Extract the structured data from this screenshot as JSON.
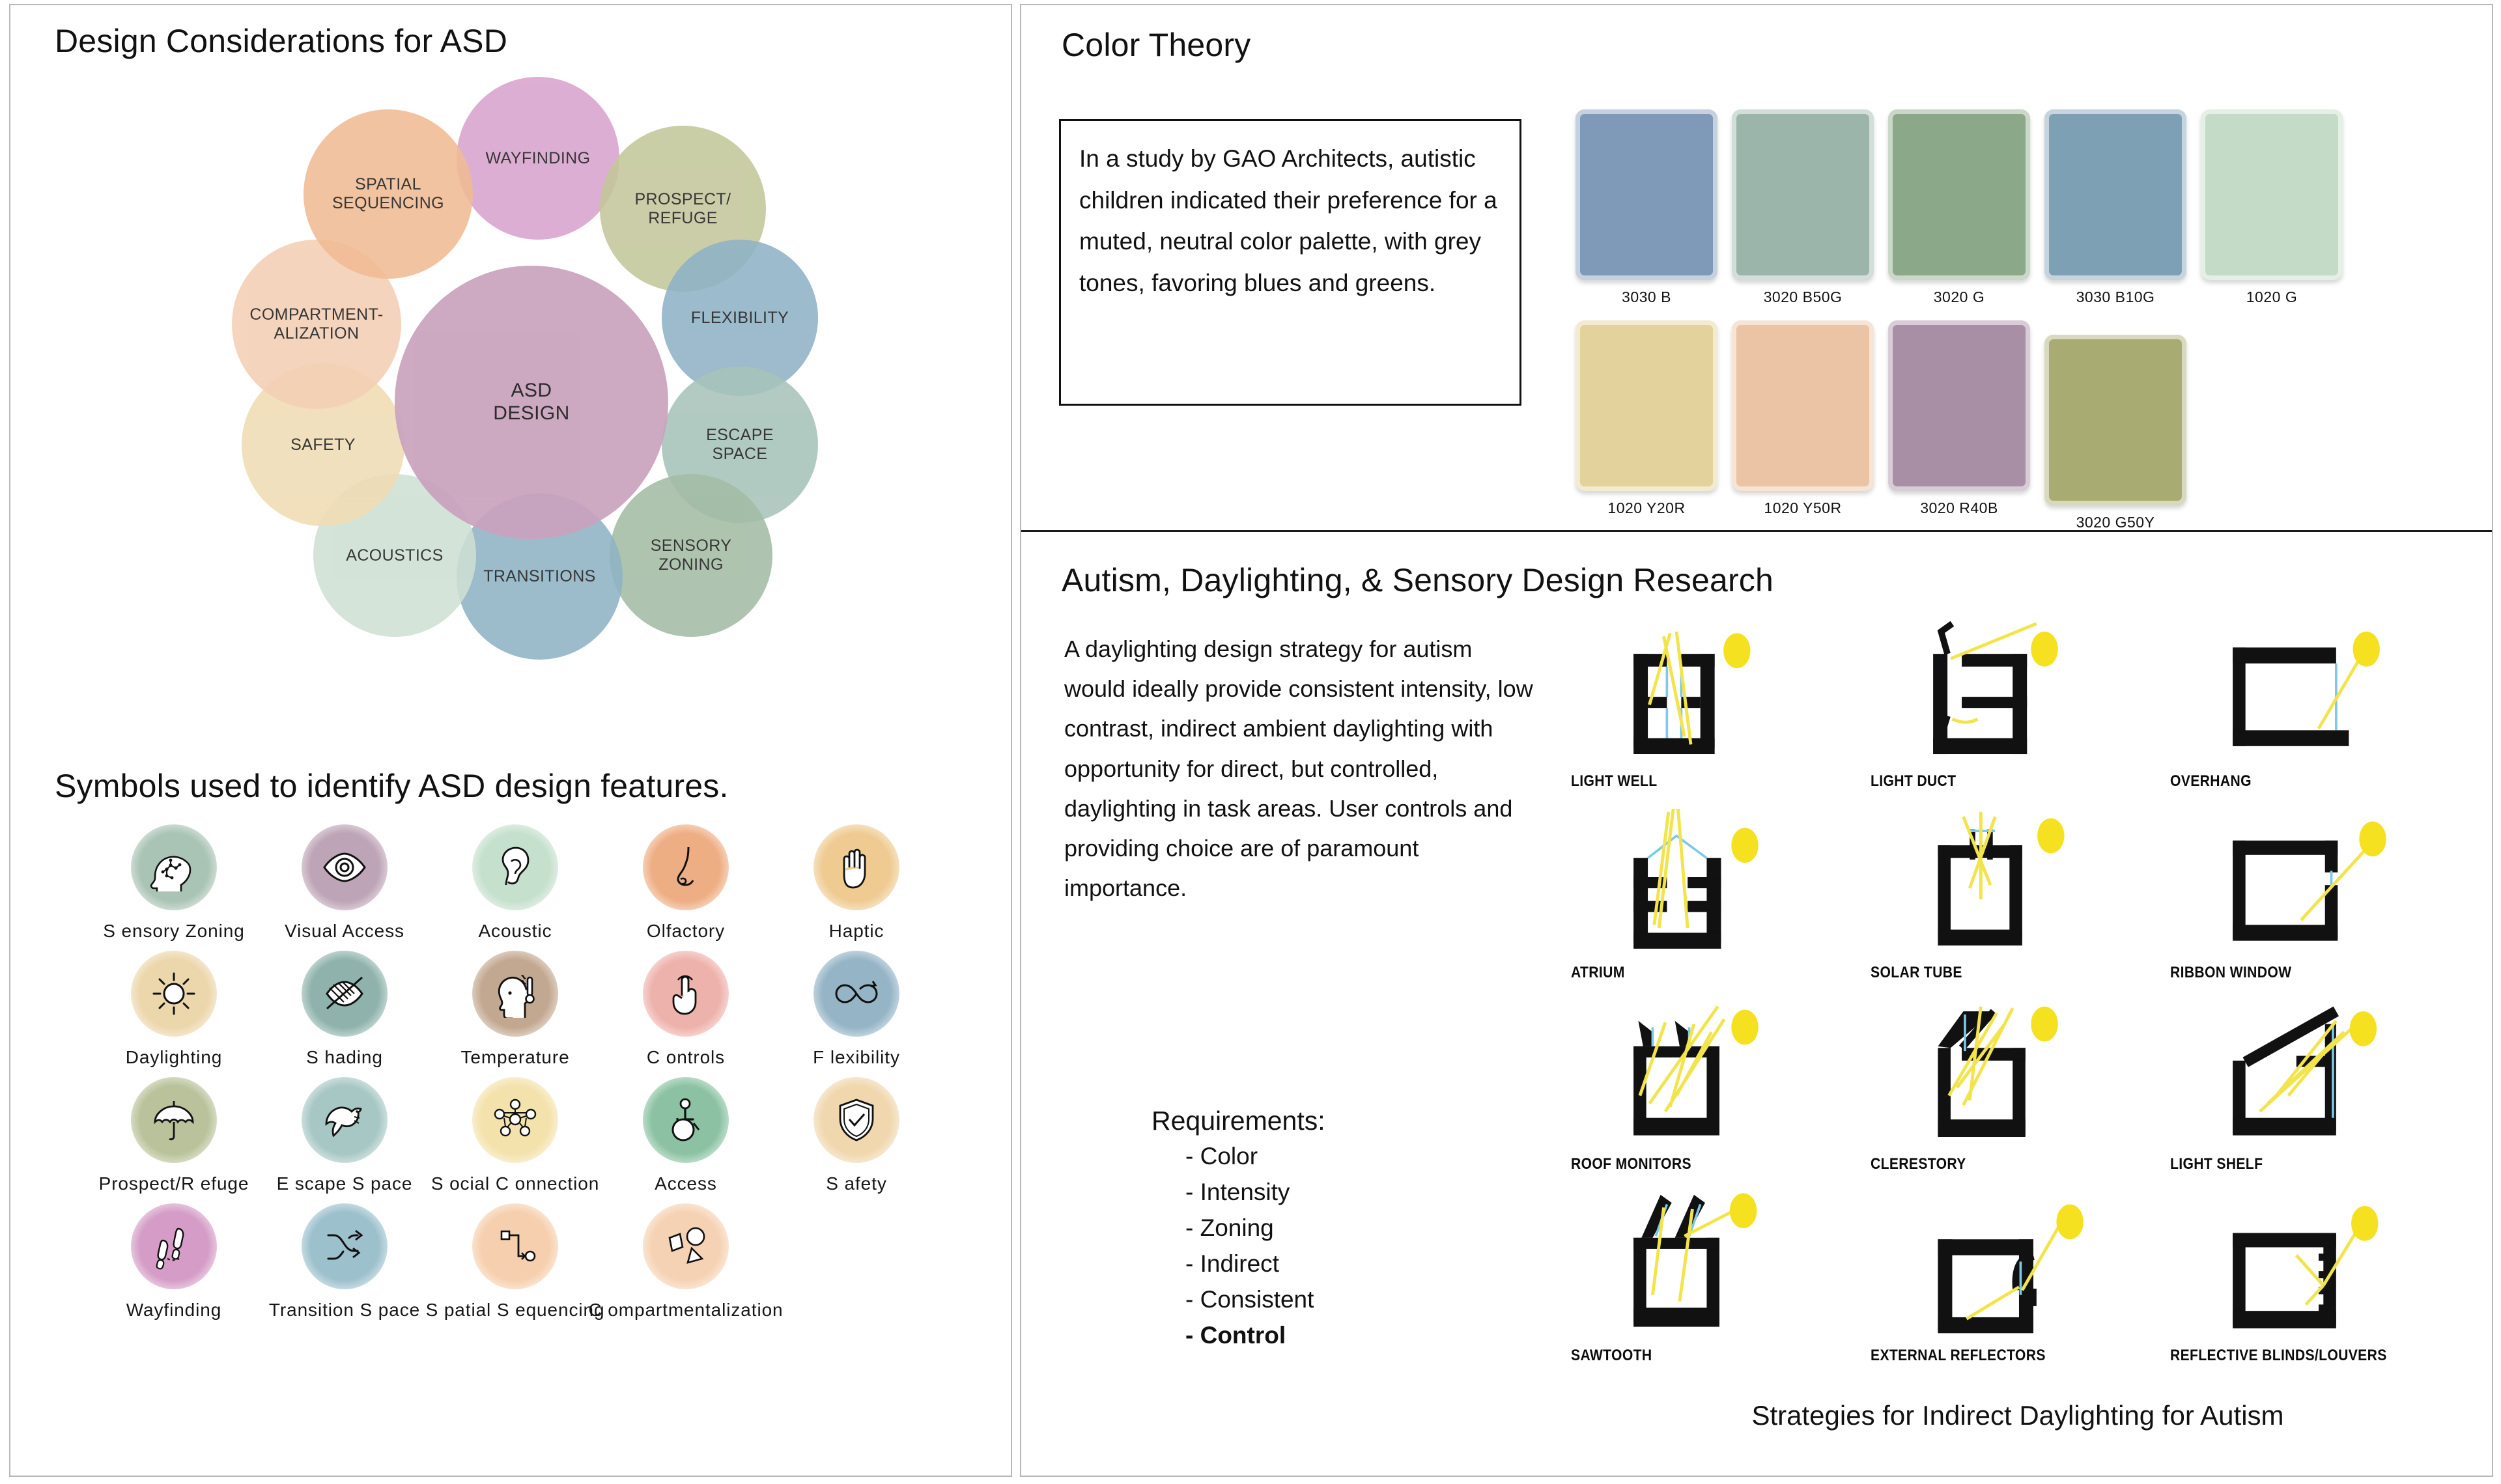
{
  "left_panel": {
    "title": "Design Considerations for ASD",
    "bubble_diagram": {
      "core_label": "ASD\nDESIGN",
      "bubbles": [
        {
          "label": "WAYFINDING",
          "color": "#d9a3cd"
        },
        {
          "label": "PROSPECT/\nREFUGE",
          "color": "#c3c79b"
        },
        {
          "label": "FLEXIBILITY",
          "color": "#8fb2c6"
        },
        {
          "label": "ESCAPE\nSPACE",
          "color": "#a7c3b9"
        },
        {
          "label": "SENSORY\nZONING",
          "color": "#a3bca5"
        },
        {
          "label": "TRANSITIONS",
          "color": "#8fb3c4"
        },
        {
          "label": "ACOUSTICS",
          "color": "#cfe0d3"
        },
        {
          "label": "SAFETY",
          "color": "#f0dcb4"
        },
        {
          "label": "COMPARTMENT-\nALIZATION",
          "color": "#f4cfb4"
        },
        {
          "label": "SPATIAL\nSEQUENCING",
          "color": "#f0bb94"
        }
      ],
      "core_color": "#c9a2bd"
    },
    "symbols_title": "Symbols used to identify ASD design features.",
    "symbol_rows": [
      [
        {
          "label": "S ensory Zoning",
          "icon": "head-circuit-icon",
          "color": "#a9c3b4"
        },
        {
          "label": "Visual Access",
          "icon": "eye-icon",
          "color": "#bda4b6"
        },
        {
          "label": "Acoustic",
          "icon": "ear-icon",
          "color": "#c5e0cd"
        },
        {
          "label": "Olfactory",
          "icon": "nose-icon",
          "color": "#eeae84"
        },
        {
          "label": "Haptic",
          "icon": "hand-open-icon",
          "color": "#efcb92"
        }
      ],
      [
        {
          "label": "Daylighting",
          "icon": "sun-icon",
          "color": "#ecd6ab"
        },
        {
          "label": "S hading",
          "icon": "eye-slash-icon",
          "color": "#8fb3ac"
        },
        {
          "label": "Temperature",
          "icon": "head-thermometer-icon",
          "color": "#c3a891"
        },
        {
          "label": "C ontrols",
          "icon": "finger-tap-icon",
          "color": "#eeb2ac"
        },
        {
          "label": "F lexibility",
          "icon": "infinity-icon",
          "color": "#95b4c6"
        }
      ],
      [
        {
          "label": "Prospect/R efuge",
          "icon": "umbrella-icon",
          "color": "#b9c29a"
        },
        {
          "label": "E scape S pace",
          "icon": "dove-icon",
          "color": "#a7c7c4"
        },
        {
          "label": "S ocial C onnection",
          "icon": "network-icon",
          "color": "#f4e2ac"
        },
        {
          "label": "Access",
          "icon": "wheelchair-icon",
          "color": "#8cc2a3"
        },
        {
          "label": "S afety",
          "icon": "shield-check-icon",
          "color": "#f0d7ae"
        }
      ],
      [
        {
          "label": "Wayfinding",
          "icon": "footsteps-icon",
          "color": "#d49cc6"
        },
        {
          "label": "Transition S pace",
          "icon": "shuffle-icon",
          "color": "#9cc0cc"
        },
        {
          "label": "S patial S equencing",
          "icon": "sequence-path-icon",
          "color": "#f6cfae"
        },
        {
          "label": "C ompartmentalization",
          "icon": "shapes-icon",
          "color": "#f6d2b4"
        }
      ]
    ]
  },
  "right_top": {
    "title": "Color Theory",
    "quote": "In a study by GAO Architects, autistic children indicated their preference for a muted, neutral color palette, with grey tones, favoring blues and greens.",
    "swatch_rows": [
      [
        {
          "name": "3030 B",
          "color": "#7e9ab8"
        },
        {
          "name": "3020 B50G",
          "color": "#9cb5ab"
        },
        {
          "name": "3020 G",
          "color": "#8ba888"
        },
        {
          "name": "3030 B10G",
          "color": "#7ea0b5"
        },
        {
          "name": "1020 G",
          "color": "#c3dbc7"
        }
      ],
      [
        {
          "name": "1020 Y20R",
          "color": "#e3d29c"
        },
        {
          "name": "1020 Y50R",
          "color": "#eac4a4"
        },
        {
          "name": "3020 R40B",
          "color": "#a98fa6"
        },
        {
          "name": "3020 G50Y",
          "color": "#a8ac72"
        }
      ]
    ]
  },
  "right_bottom": {
    "title": "Autism, Daylighting, & Sensory Design Research",
    "paragraph": "A daylighting design strategy for autism would ideally provide consistent intensity, low contrast, indirect ambient daylighting with opportunity for direct, but controlled, daylighting in task areas. User controls and providing choice are of paramount importance.",
    "requirements_heading": "Requirements:",
    "requirements": [
      "- Color",
      "- Intensity",
      "- Zoning",
      "- Indirect",
      "- Consistent",
      "- Control"
    ],
    "diagram_caption": "Strategies for Indirect Daylighting for Autism",
    "diagram_rows": [
      [
        {
          "label": "LIGHT WELL"
        },
        {
          "label": "LIGHT DUCT"
        },
        {
          "label": "OVERHANG"
        }
      ],
      [
        {
          "label": "ATRIUM"
        },
        {
          "label": "SOLAR TUBE"
        },
        {
          "label": "RIBBON WINDOW"
        }
      ],
      [
        {
          "label": "ROOF MONITORS"
        },
        {
          "label": "CLERESTORY"
        },
        {
          "label": "LIGHT SHELF"
        }
      ],
      [
        {
          "label": "SAWTOOTH"
        },
        {
          "label": "EXTERNAL REFLECTORS"
        },
        {
          "label": "REFLECTIVE BLINDS/LOUVERS"
        }
      ]
    ],
    "colors": {
      "sun": "#f5e11f",
      "ray": "#f2e44a",
      "wall": "#111111",
      "glass": "#7ec8e8"
    }
  }
}
